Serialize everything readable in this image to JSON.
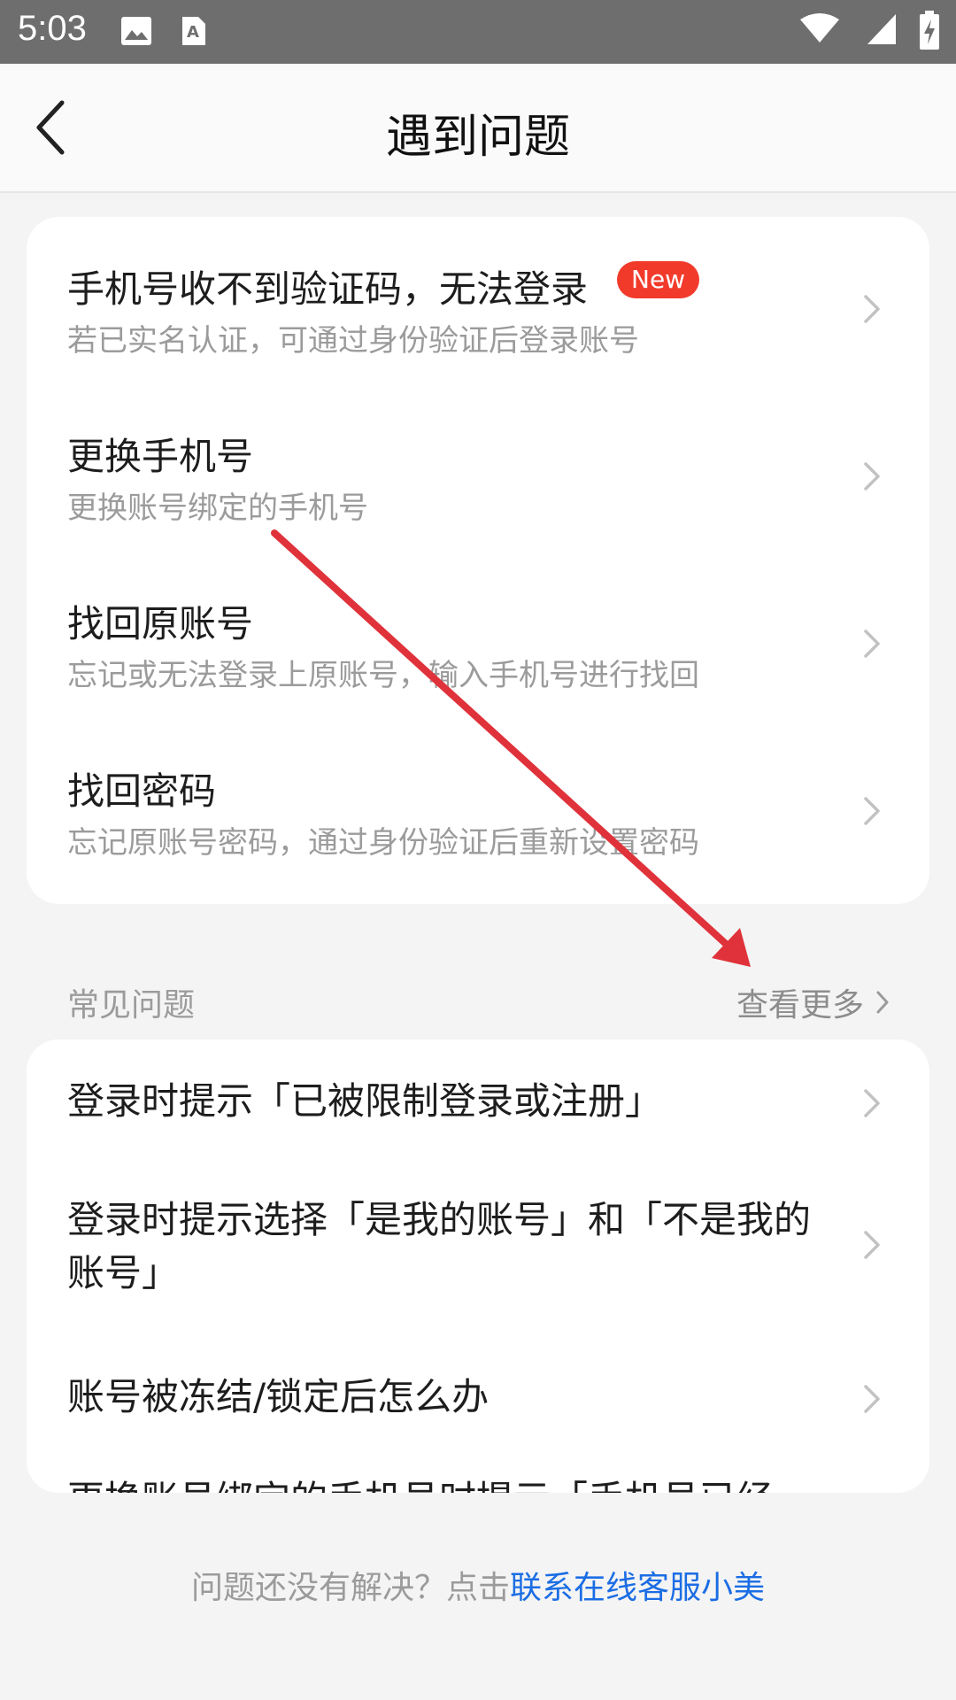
{
  "status_bar": {
    "time": "5:03"
  },
  "header": {
    "title": "遇到问题"
  },
  "top_card": {
    "items": [
      {
        "title": "手机号收不到验证码，无法登录",
        "badge": "New",
        "subtitle": "若已实名认证，可通过身份验证后登录账号"
      },
      {
        "title": "更换手机号",
        "subtitle": "更换账号绑定的手机号"
      },
      {
        "title": "找回原账号",
        "subtitle": "忘记或无法登录上原账号，输入手机号进行找回"
      },
      {
        "title": "找回密码",
        "subtitle": "忘记原账号密码，通过身份验证后重新设置密码"
      }
    ]
  },
  "faq": {
    "label": "常见问题",
    "more_label": "查看更多",
    "items": [
      {
        "text": "登录时提示「已被限制登录或注册」"
      },
      {
        "text": "登录时提示选择「是我的账号」和「不是我的账号」"
      },
      {
        "text": "账号被冻结/锁定后怎么办"
      },
      {
        "text": "更换账号绑定的手机号时提示「手机号已经"
      }
    ]
  },
  "footer": {
    "prefix": "问题还没有解决？点击",
    "link": "联系在线客服小美"
  },
  "colors": {
    "badge": "#f23a2b",
    "link": "#1b6de4",
    "annotation_arrow": "#e0323a"
  }
}
